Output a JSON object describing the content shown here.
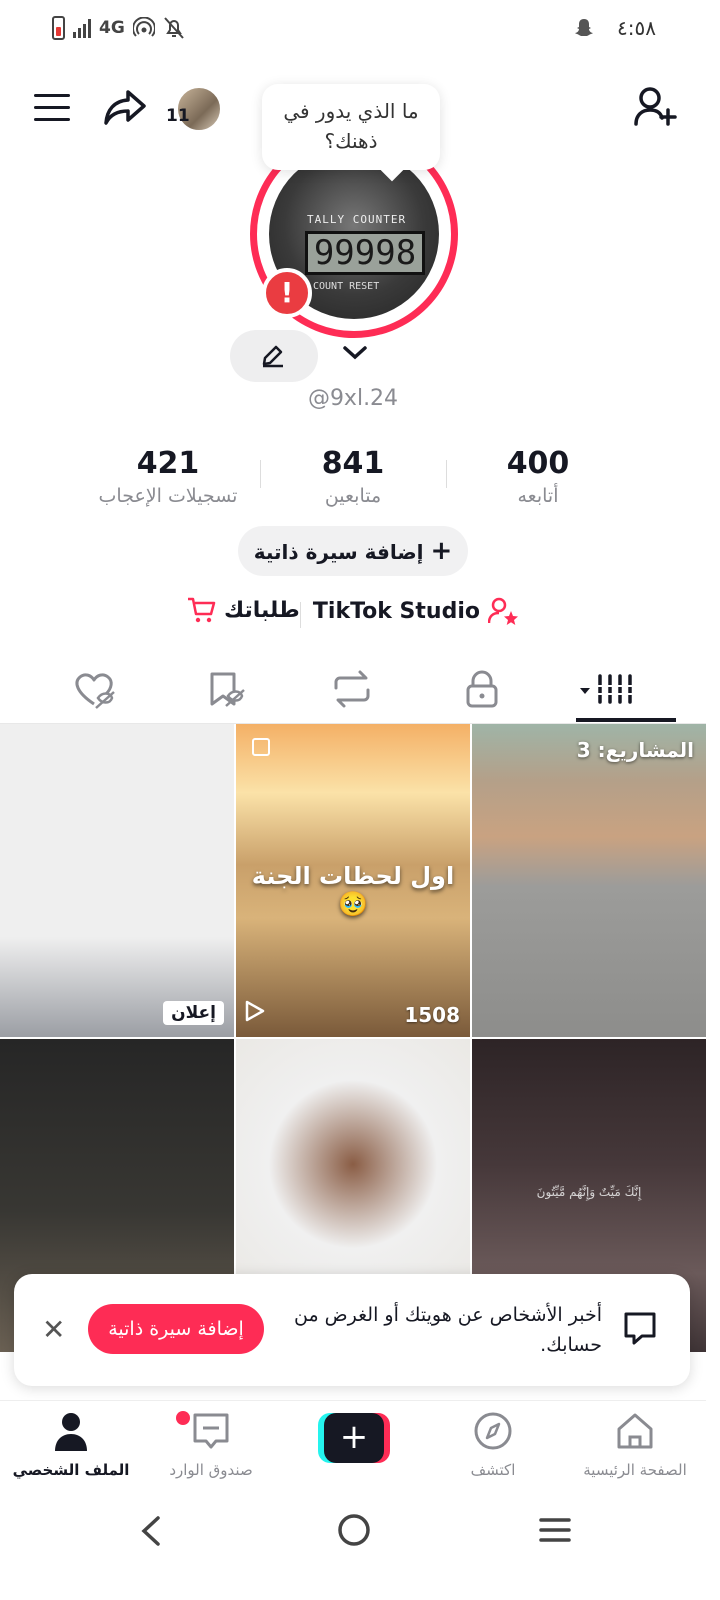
{
  "status_bar": {
    "network": "4G",
    "time": "٤:٥٨"
  },
  "header": {
    "notification_count": "11"
  },
  "profile": {
    "bubble_text": "ما الذي يدور في ذهنك؟",
    "counter_label": "TALLY  COUNTER",
    "counter_value": "99998",
    "counter_footer": "COUNT    RESET",
    "username": "@9xl.24",
    "stats": [
      {
        "value": "400",
        "label": "أتابعه"
      },
      {
        "value": "841",
        "label": "متابعين"
      },
      {
        "value": "421",
        "label": "تسجيلات الإعجاب"
      }
    ],
    "add_bio_label": "إضافة سيرة ذاتية",
    "tiktok_studio_label": "TikTok Studio",
    "orders_label": "طلباتك"
  },
  "tabs": {
    "items": [
      "videos",
      "private",
      "reposts",
      "favorites",
      "liked"
    ],
    "active": "videos"
  },
  "grid": {
    "ad_label": "إعلان",
    "video_title": "اول لحظات الجنة 🥹",
    "video_views": "1508",
    "drafts_label": "المشاريع: 3",
    "quote_text": "إِنَّكَ مَيِّتٌ وَإِنَّهُم مَّيِّتُونَ"
  },
  "toast": {
    "message": "أخبر الأشخاص عن هويتك أو الغرض من حسابك.",
    "button_label": "إضافة سيرة ذاتية"
  },
  "bottom_nav": {
    "home": "الصفحة الرئيسية",
    "explore": "اكتشف",
    "inbox": "صندوق الوارد",
    "profile": "الملف الشخصي"
  },
  "colors": {
    "accent": "#fe2c55",
    "cyan": "#25f4ee",
    "text": "#161823",
    "muted": "#8a8b91"
  }
}
